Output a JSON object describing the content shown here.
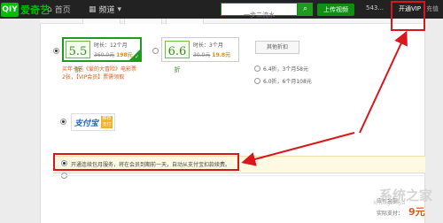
{
  "topbar": {
    "logo_mark": "QIY",
    "logo_text": "爱奇艺",
    "home_label": "首页",
    "channels_label": "频道",
    "search_placeholder": "一步二流水",
    "upload_label": "上传视频",
    "user_count": "543...",
    "vip_label": "开通VIP",
    "more_text": "充值"
  },
  "plans": [
    {
      "discount": "5.5",
      "unit": "折",
      "duration": "时长：12个月",
      "old_price": "360.0元",
      "new_price": "198元",
      "selected": true
    },
    {
      "discount": "6.6",
      "unit": "折",
      "duration": "时长：3个月",
      "old_price": "30.0元",
      "new_price": "19.8元",
      "selected": false
    }
  ],
  "promo_text": [
    "买年卡送《爱的大冒险》电影票",
    "2张，【VIP会员】票需领取"
  ],
  "other_plans": {
    "title": "其他折扣",
    "options": [
      "6.4折，3个月58元",
      "6.0折，6个月108元"
    ]
  },
  "payment": {
    "alipay_label": "支付宝",
    "alipay_badge": "推荐 支付"
  },
  "auto_renew": {
    "text": "开通连续包月服务，将在会员到期前一天，自动从支付宝扣款续费。"
  },
  "summary": {
    "line1": "应付金额：",
    "line2": "实际支付：",
    "price": "9元"
  },
  "watermark": {
    "title": "系统之家",
    "sub": "XiTongZhiJia"
  },
  "colors": {
    "brand_green": "#00be06",
    "highlight_red": "#d9161c",
    "price_orange": "#f08a00"
  }
}
